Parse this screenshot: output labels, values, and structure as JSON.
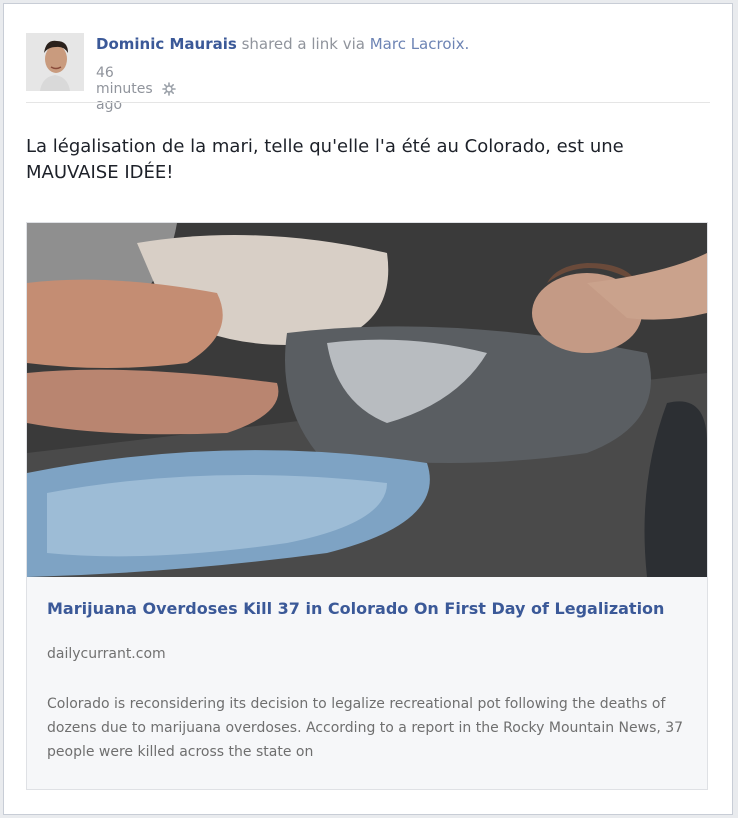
{
  "post": {
    "author": "Dominic Maurais",
    "action": "shared a link via",
    "via": "Marc Lacroix.",
    "time": "46 minutes ago",
    "privacy_icon": "gear-icon",
    "text": "La légalisation de la mari, telle qu'elle l'a été au Colorado, est une MAUVAISE IDÉE!"
  },
  "link": {
    "title": "Marijuana Overdoses Kill 37 in Colorado On First Day of Legalization",
    "domain": "dailycurrant.com",
    "description": "Colorado is reconsidering its decision to legalize recreational pot following the deaths of dozens due to marijuana overdoses. According to a report in the Rocky Mountain News, 37 people were killed across the state on"
  },
  "colors": {
    "link_blue": "#3b5998",
    "meta_gray": "#90949c",
    "body_text": "#1d2129"
  }
}
